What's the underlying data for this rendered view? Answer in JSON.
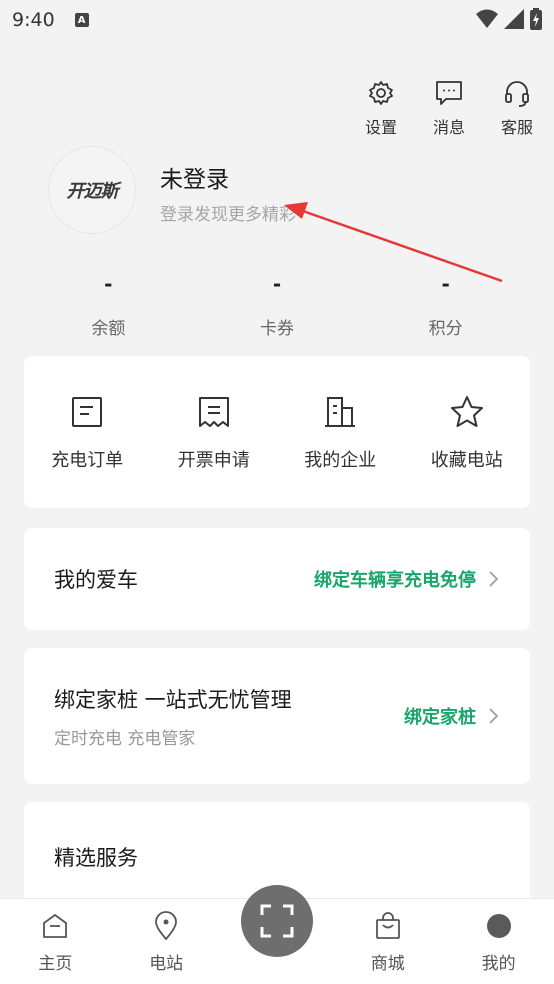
{
  "status_bar": {
    "time": "9:40",
    "notification": "A"
  },
  "top_actions": [
    {
      "label": "设置",
      "icon": "gear-icon"
    },
    {
      "label": "消息",
      "icon": "message-icon"
    },
    {
      "label": "客服",
      "icon": "headset-icon"
    }
  ],
  "profile": {
    "logo_text": "开迈斯",
    "name": "未登录",
    "subtitle": "登录发现更多精彩"
  },
  "stats": [
    {
      "value": "-",
      "label": "余额"
    },
    {
      "value": "-",
      "label": "卡券"
    },
    {
      "value": "-",
      "label": "积分"
    }
  ],
  "quick_menu": [
    {
      "label": "充电订单",
      "icon": "order-icon"
    },
    {
      "label": "开票申请",
      "icon": "invoice-icon"
    },
    {
      "label": "我的企业",
      "icon": "building-icon"
    },
    {
      "label": "收藏电站",
      "icon": "star-icon"
    }
  ],
  "car": {
    "title": "我的爱车",
    "link": "绑定车辆享充电免停"
  },
  "pile": {
    "title": "绑定家桩 一站式无忧管理",
    "subtitle": "定时充电 充电管家",
    "link": "绑定家桩"
  },
  "services": {
    "title": "精选服务"
  },
  "tabs": [
    {
      "label": "主页",
      "icon": "home-icon"
    },
    {
      "label": "电站",
      "icon": "location-pin-icon"
    },
    {
      "label": "商城",
      "icon": "shopping-bag-icon"
    },
    {
      "label": "我的",
      "icon": "profile-dot-icon"
    }
  ],
  "colors": {
    "accent": "#1aa56c",
    "annotation": "#e53935",
    "scan": "#6e6e6e"
  }
}
